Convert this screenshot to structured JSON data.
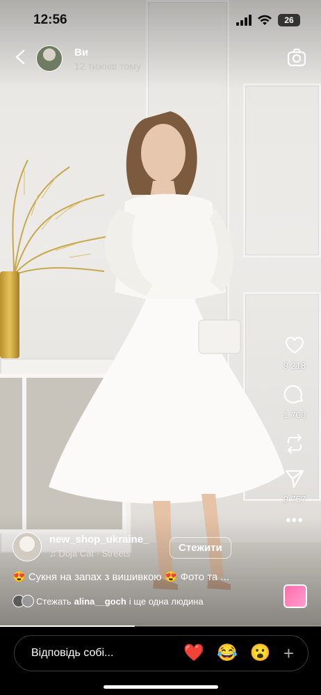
{
  "status_bar": {
    "time": "12:56",
    "battery": "26"
  },
  "header": {
    "user": "Ви",
    "time_ago": "12 тижнів тому"
  },
  "actions": {
    "likes": "9 218",
    "comments": "1 700",
    "shares": "9 757"
  },
  "post": {
    "author": "new_shop_ukraine_",
    "song": "Doja Cat · Streets",
    "follow_label": "Стежити",
    "caption": "😍 Сукня на запах з вишивкою 😍 Фото та ...",
    "followers_prefix": "Стежать",
    "followers_name": "alina__goch",
    "followers_suffix": "і ще одна людина"
  },
  "reply": {
    "placeholder": "Відповідь собі...",
    "reactions": [
      "❤️",
      "😂",
      "😮"
    ],
    "plus": "+"
  },
  "colors": {
    "accent": "#ffffff",
    "background": "#000000"
  },
  "progress": 0.42
}
